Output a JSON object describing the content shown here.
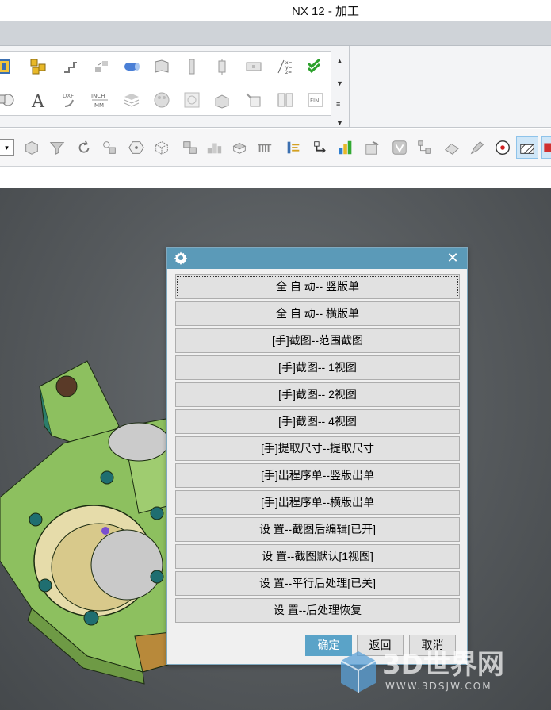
{
  "app": {
    "title": "NX 12 - 加工"
  },
  "ribbon": {
    "row1_icons": [
      "assembly-icon",
      "gold-blocks-icon",
      "steps-icon",
      "exploded-icon",
      "cylinder-icon",
      "surface-icon",
      "bolt-icon",
      "pin-icon",
      "plate-icon",
      "formula-icon",
      "check-list-icon"
    ],
    "row2_icons": [
      "shape-icon",
      "text-A-icon",
      "dxf-export-icon",
      "inch-mm-icon",
      "layers-icon",
      "palette-icon",
      "texture-icon",
      "box-export-icon",
      "tag-icon",
      "window-icon",
      "fin-icon"
    ],
    "text_A": "A",
    "dxf_label": "DXF",
    "inch_label": "INCH",
    "mm_label": "MM",
    "fin_label": "FIN",
    "formula_lines": [
      "x=",
      "y=",
      "z="
    ]
  },
  "toolbar": {
    "combo_arrow": "▾",
    "icons": [
      "part-move-icon",
      "filter-icon",
      "rotate-icon",
      "snap-icon",
      "hexagon-icon",
      "box-wire-icon",
      "block-stack-icon",
      "multi-blocks-icon",
      "sheet-icon",
      "comb-icon",
      "ruler-icon",
      "sequence-icon",
      "stack-chart-icon",
      "edit-check-icon",
      "verify-icon",
      "tree-icon",
      "eraser-icon",
      "marker-icon",
      "compass-icon",
      "hatch-icon",
      "extra-icon"
    ]
  },
  "dialog": {
    "title": "",
    "options": [
      "全 自 动-- 竖版单",
      "全 自 动-- 横版单",
      "[手]截图--范围截图",
      "[手]截图-- 1视图",
      "[手]截图-- 2视图",
      "[手]截图-- 4视图",
      "[手]提取尺寸--提取尺寸",
      "[手]出程序单--竖版出单",
      "[手]出程序单--横版出单",
      "设 置--截图后编辑[已开]",
      "设 置--截图默认[1视图]",
      "设 置--平行后处理[已关]",
      "设 置--后处理恢复"
    ],
    "ok_label": "确定",
    "back_label": "返回",
    "cancel_label": "取消"
  },
  "watermark": {
    "brand": "3D世界网",
    "url": "WWW.3DSJW.COM"
  },
  "colors": {
    "dialog_title": "#5b9ab8",
    "part_green": "#8dc05f",
    "viewport": "#55595c"
  }
}
